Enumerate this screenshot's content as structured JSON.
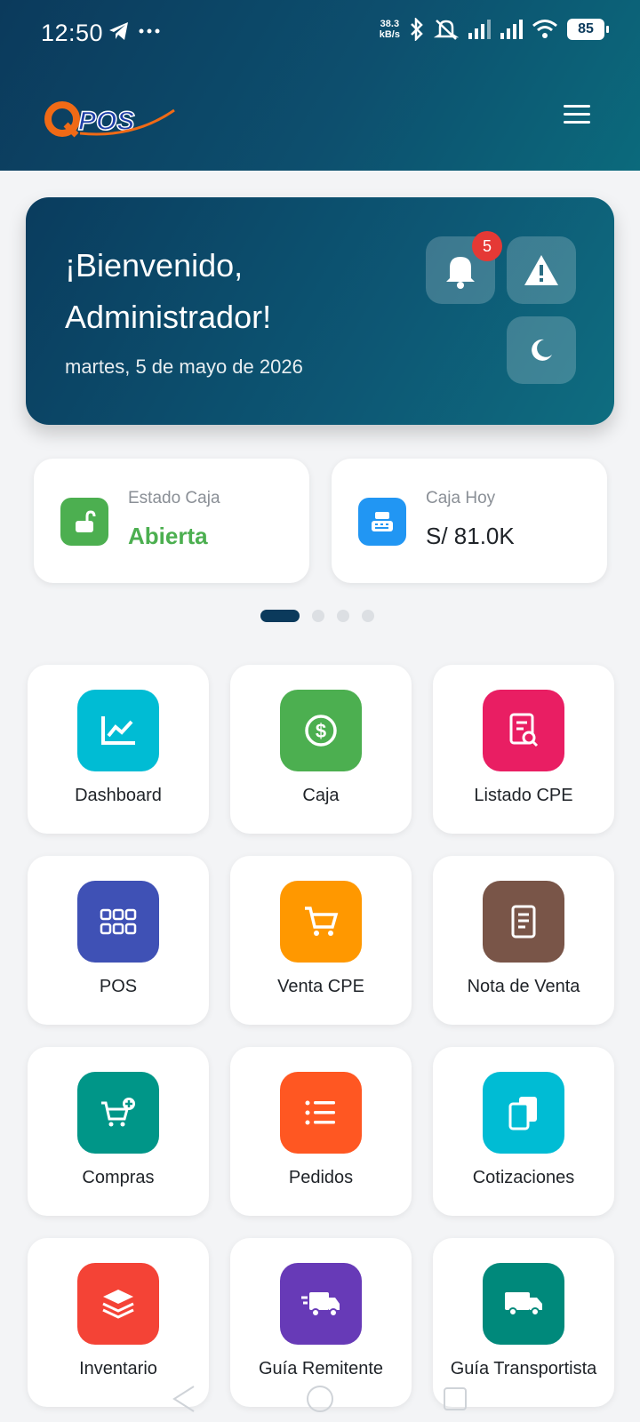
{
  "status": {
    "time": "12:50",
    "speed_top": "38.3",
    "speed_unit": "kB/s",
    "battery": "85"
  },
  "header": {
    "logo_text": "QPOS",
    "menu_icon": "hamburger-menu-icon"
  },
  "welcome": {
    "title": "¡Bienvenido, Administrador!",
    "date": "martes, 5 de mayo de 2026",
    "notifications_count": "5"
  },
  "stats": [
    {
      "label": "Estado Caja",
      "value": "Abierta",
      "icon": "unlock-icon",
      "color": "#4caf50",
      "value_color": "#4caf50"
    },
    {
      "label": "Caja Hoy",
      "value": "S/ 81.0K",
      "icon": "cash-register-icon",
      "color": "#2196f3",
      "value_color": "#1f2328"
    }
  ],
  "carousel": {
    "pages": 4,
    "active": 0
  },
  "tiles": [
    {
      "label": "Dashboard",
      "icon": "chart-line-icon",
      "color": "#00bcd4"
    },
    {
      "label": "Caja",
      "icon": "dollar-circle-icon",
      "color": "#4caf50"
    },
    {
      "label": "Listado CPE",
      "icon": "document-search-icon",
      "color": "#e91e63"
    },
    {
      "label": "POS",
      "icon": "grid-icon",
      "color": "#3f51b5"
    },
    {
      "label": "Venta CPE",
      "icon": "cart-icon",
      "color": "#ff9800"
    },
    {
      "label": "Nota de Venta",
      "icon": "note-icon",
      "color": "#795548"
    },
    {
      "label": "Compras",
      "icon": "cart-plus-icon",
      "color": "#009688"
    },
    {
      "label": "Pedidos",
      "icon": "list-icon",
      "color": "#ff5722"
    },
    {
      "label": "Cotizaciones",
      "icon": "copy-icon",
      "color": "#00bcd4"
    },
    {
      "label": "Inventario",
      "icon": "layers-icon",
      "color": "#f44336"
    },
    {
      "label": "Guía Remitente",
      "icon": "fast-truck-icon",
      "color": "#673ab7"
    },
    {
      "label": "Guía Transportista",
      "icon": "truck-icon",
      "color": "#00897b"
    }
  ]
}
